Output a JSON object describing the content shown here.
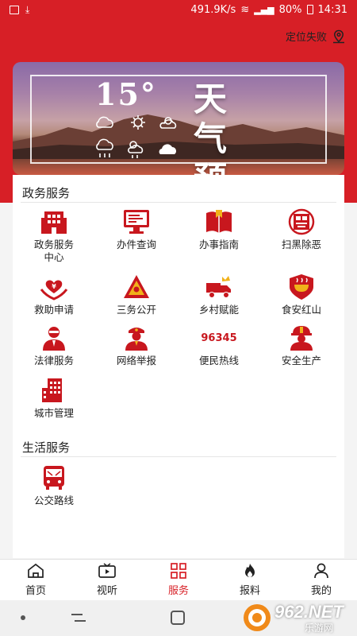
{
  "status_bar": {
    "net_speed": "491.9K/s",
    "battery": "80%",
    "time": "14:31"
  },
  "location": {
    "text": "定位失败"
  },
  "banner": {
    "temperature": "15°",
    "title_line1": "天 气",
    "title_line2": "预 报"
  },
  "sections": [
    {
      "title": "政务服务",
      "items": [
        {
          "label": "政务服务",
          "label2": "中心",
          "icon": "government-building-icon"
        },
        {
          "label": "办件查询",
          "icon": "monitor-query-icon"
        },
        {
          "label": "办事指南",
          "icon": "open-book-icon"
        },
        {
          "label": "扫黑除恶",
          "icon": "anti-crime-badge-icon"
        },
        {
          "label": "救助申请",
          "icon": "helping-hands-icon"
        },
        {
          "label": "三务公开",
          "icon": "triangle-disclosure-icon"
        },
        {
          "label": "乡村赋能",
          "icon": "rural-truck-icon"
        },
        {
          "label": "食安红山",
          "icon": "food-safety-bowl-icon"
        },
        {
          "label": "法律服务",
          "icon": "lawyer-icon"
        },
        {
          "label": "网络举报",
          "icon": "police-officer-icon"
        },
        {
          "label": "便民热线",
          "icon": "hotline-number-icon",
          "icon_text": "96345"
        },
        {
          "label": "安全生产",
          "icon": "hard-hat-worker-icon"
        },
        {
          "label": "城市管理",
          "icon": "city-building-icon"
        }
      ]
    },
    {
      "title": "生活服务",
      "items": [
        {
          "label": "公交路线",
          "icon": "bus-icon"
        }
      ]
    }
  ],
  "tabs": [
    {
      "label": "首页",
      "icon": "home-icon"
    },
    {
      "label": "视听",
      "icon": "tv-video-icon"
    },
    {
      "label": "服务",
      "icon": "grid-services-icon",
      "active": true
    },
    {
      "label": "报料",
      "icon": "flame-icon"
    },
    {
      "label": "我的",
      "icon": "user-icon"
    }
  ],
  "watermark": {
    "text": "962.NET",
    "subtext": "乐游网"
  },
  "colors": {
    "brand_red": "#d71f26",
    "icon_red": "#c8171e"
  }
}
